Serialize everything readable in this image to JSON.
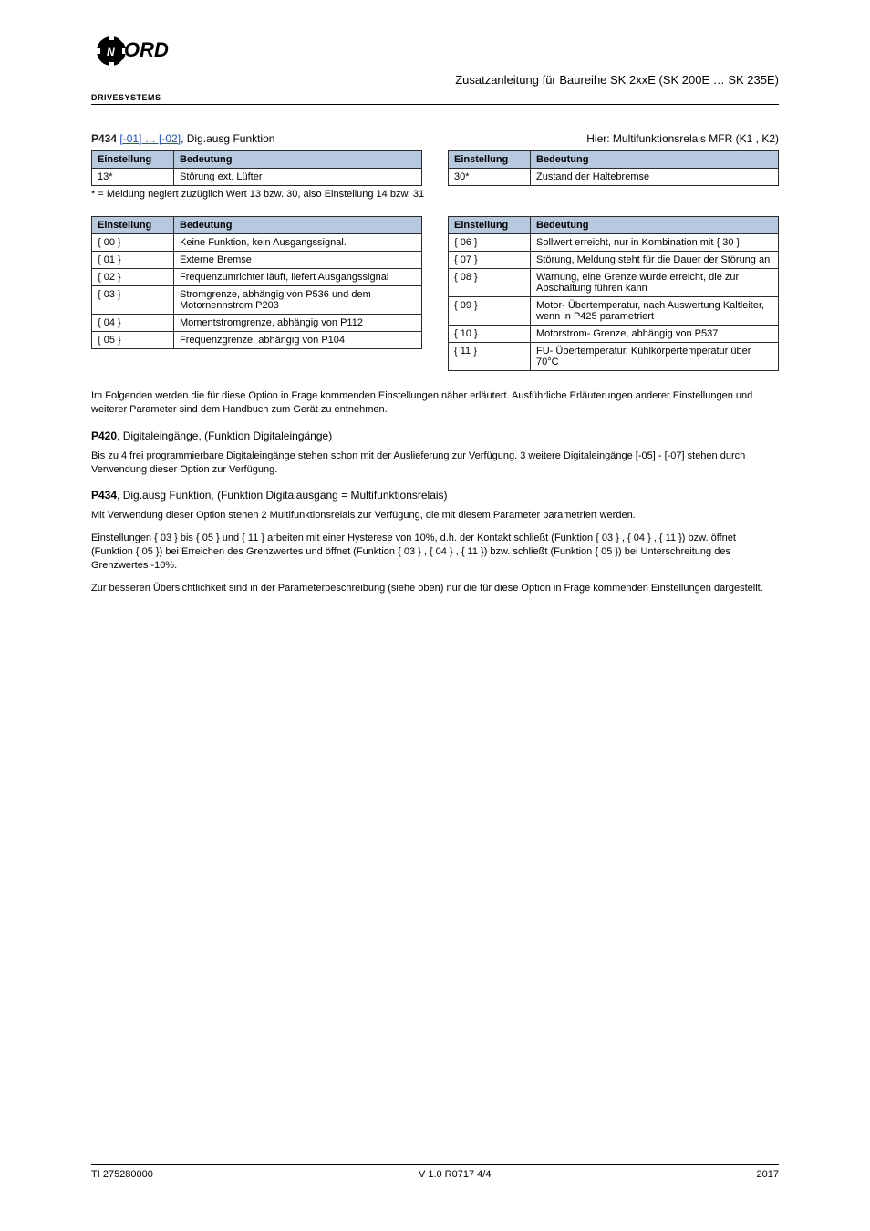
{
  "header": {
    "logo_top": "NORD",
    "logo_bottom": "DRIVESYSTEMS",
    "title": "Zusatzanleitung für Baureihe SK 2xxE (SK 200E … SK 235E)"
  },
  "section1": {
    "label": "P434",
    "link_text": "[-01] … [-02]",
    "after_link": ", Dig.ausg Funktion",
    "relay_note": "Hier: Multifunktionsrelais MFR (K1 , K2)",
    "left_table": {
      "headers": [
        "Einstellung",
        "Bedeutung"
      ],
      "rows": [
        {
          "setting": "13*",
          "meaning": "Störung ext. Lüfter"
        }
      ]
    },
    "right_table": {
      "headers": [
        "Einstellung",
        "Bedeutung"
      ],
      "rows": [
        {
          "setting": "30*",
          "meaning": "Zustand der Haltebremse"
        }
      ]
    },
    "note_left": "* = Meldung negiert zuzüglich Wert 13 bzw. 30, also Einstellung 14 bzw. 31"
  },
  "table2": {
    "left": {
      "headers": [
        "Einstellung",
        "Bedeutung"
      ],
      "rows": [
        {
          "setting": "{ 00 }",
          "meaning": "Keine Funktion, kein Ausgangssignal."
        },
        {
          "setting": "{ 01 }",
          "meaning": "Externe Bremse"
        },
        {
          "setting": "{ 02 }",
          "meaning": "Frequenzumrichter läuft, liefert Ausgangssignal"
        },
        {
          "setting": "{ 03 }",
          "meaning": "Stromgrenze, abhängig von P536 und dem Motornennstrom P203"
        },
        {
          "setting": "{ 04 }",
          "meaning": "Momentstromgrenze, abhängig von P112"
        },
        {
          "setting": "{ 05 }",
          "meaning": "Frequenzgrenze, abhängig von P104"
        }
      ]
    },
    "right": {
      "headers": [
        "Einstellung",
        "Bedeutung"
      ],
      "rows": [
        {
          "setting": "{ 06 }",
          "meaning": "Sollwert erreicht, nur in Kombination mit { 30 }"
        },
        {
          "setting": "{ 07 }",
          "meaning": "Störung, Meldung steht für die Dauer der Störung an"
        },
        {
          "setting": "{ 08 }",
          "meaning": "Warnung, eine Grenze wurde erreicht, die zur Abschaltung führen kann"
        },
        {
          "setting": "{ 09 }",
          "meaning": "Motor- Übertemperatur, nach Auswertung Kaltleiter, wenn in P425 parametriert"
        },
        {
          "setting": "{ 10 }",
          "meaning": "Motorstrom- Grenze, abhängig von P537"
        },
        {
          "setting": "{ 11 }",
          "meaning": "FU- Übertemperatur, Kühlkörpertemperatur über 70°C"
        }
      ]
    }
  },
  "intro_text": "Im Folgenden werden die für diese Option in Frage kommenden Einstellungen näher erläutert. Ausführliche Erläuterungen anderer Einstellungen und weiterer Parameter sind dem Handbuch zum Gerät zu entnehmen.",
  "section2": {
    "label": "P420",
    "after_link": ", Digitaleingänge",
    "rest": ", (Funktion Digitaleingänge)",
    "desc": "Bis zu 4 frei programmierbare Digitaleingänge stehen schon mit der Auslieferung zur Verfügung. 3 weitere Digitaleingänge [-05] - [-07] stehen durch Verwendung dieser Option zur Verfügung."
  },
  "section3": {
    "label": "P434",
    "after_link": ", Dig.ausg Funktion",
    "rest": ", (Funktion Digitalausgang = Multifunktionsrelais)",
    "paragraphs": [
      "Mit Verwendung dieser Option stehen 2 Multifunktionsrelais zur Verfügung, die mit diesem Parameter parametriert werden.",
      "Einstellungen { 03 } bis { 05 } und { 11 } arbeiten mit einer Hysterese von 10%, d.h. der Kontakt schließt (Funktion { 03 } , { 04 } , { 11 }) bzw. öffnet (Funktion { 05 }) bei Erreichen des Grenzwertes und öffnet (Funktion { 03 } , { 04 } , { 11 }) bzw. schließt (Funktion { 05 }) bei Unterschreitung des Grenzwertes -10%.",
      "Zur besseren Übersichtlichkeit sind in der Parameterbeschreibung (siehe oben) nur die für diese Option in Frage kommenden Einstellungen dargestellt."
    ]
  },
  "footer": {
    "left": "TI 275280000",
    "center": "V 1.0 R0717 4/4",
    "right": "2017"
  }
}
